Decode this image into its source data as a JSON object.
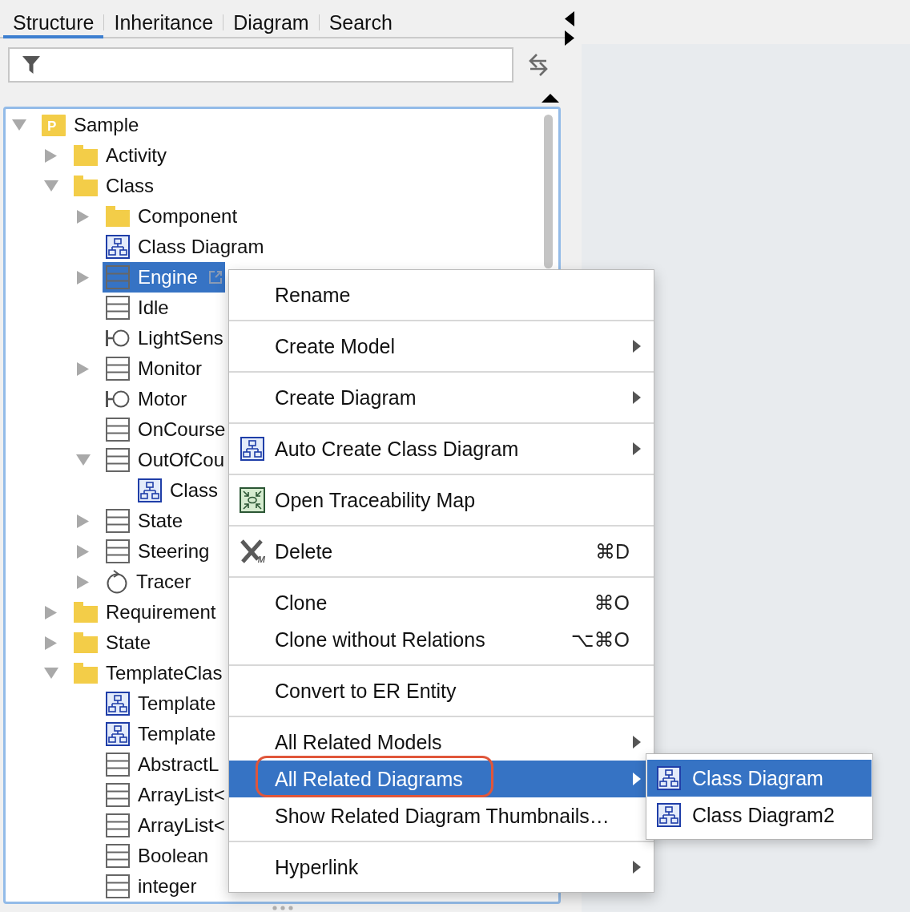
{
  "tabs": [
    {
      "label": "Structure",
      "selected": true
    },
    {
      "label": "Inheritance",
      "selected": false
    },
    {
      "label": "Diagram",
      "selected": false
    },
    {
      "label": "Search",
      "selected": false
    }
  ],
  "tree": [
    {
      "label": "Sample",
      "kind": "project",
      "icon_letter": "P",
      "expanded": true,
      "selected": false,
      "children": [
        {
          "label": "Activity",
          "kind": "folder",
          "expanded": false,
          "selected": false
        },
        {
          "label": "Class",
          "kind": "folder",
          "expanded": true,
          "selected": false,
          "children": [
            {
              "label": "Component",
              "kind": "folder",
              "expanded": false,
              "selected": false
            },
            {
              "label": "Class Diagram",
              "kind": "diagram",
              "selected": false
            },
            {
              "label": "Engine",
              "kind": "class",
              "expanded": false,
              "selected": true,
              "link_icon": true
            },
            {
              "label": "Idle",
              "kind": "class",
              "selected": false
            },
            {
              "label": "LightSens",
              "kind": "interface",
              "selected": false
            },
            {
              "label": "Monitor",
              "kind": "class",
              "expanded": false,
              "selected": false
            },
            {
              "label": "Motor",
              "kind": "interface",
              "selected": false
            },
            {
              "label": "OnCourse",
              "kind": "class",
              "selected": false
            },
            {
              "label": "OutOfCou",
              "kind": "class",
              "expanded": true,
              "selected": false,
              "children": [
                {
                  "label": "Class",
                  "kind": "diagram",
                  "selected": false
                }
              ]
            },
            {
              "label": "State",
              "kind": "class",
              "expanded": false,
              "selected": false
            },
            {
              "label": "Steering",
              "kind": "class",
              "expanded": false,
              "selected": false
            },
            {
              "label": "Tracer",
              "kind": "control",
              "expanded": false,
              "selected": false
            }
          ]
        },
        {
          "label": "Requirement",
          "kind": "folder",
          "expanded": false,
          "selected": false
        },
        {
          "label": "State",
          "kind": "folder",
          "expanded": false,
          "selected": false
        },
        {
          "label": "TemplateClas",
          "kind": "folder",
          "expanded": true,
          "selected": false,
          "children": [
            {
              "label": "Template",
              "kind": "diagram",
              "selected": false
            },
            {
              "label": "Template",
              "kind": "diagram",
              "selected": false
            },
            {
              "label": "AbstractL",
              "kind": "class",
              "selected": false
            },
            {
              "label": "ArrayList<",
              "kind": "class",
              "selected": false
            },
            {
              "label": "ArrayList<",
              "kind": "class",
              "selected": false
            },
            {
              "label": "Boolean",
              "kind": "class",
              "selected": false
            },
            {
              "label": "integer",
              "kind": "class",
              "selected": false
            }
          ]
        }
      ]
    }
  ],
  "context_menu": {
    "groups": [
      {
        "items": [
          {
            "label": "Rename",
            "kind": "plain",
            "submenu": false,
            "highlighted": false
          }
        ]
      },
      {
        "items": [
          {
            "label": "Create Model",
            "kind": "plain",
            "submenu": true,
            "highlighted": false
          }
        ]
      },
      {
        "items": [
          {
            "label": "Create Diagram",
            "kind": "plain",
            "submenu": true,
            "highlighted": false
          }
        ]
      },
      {
        "items": [
          {
            "label": "Auto Create Class Diagram",
            "kind": "diagram",
            "submenu": true,
            "highlighted": false
          }
        ]
      },
      {
        "items": [
          {
            "label": "Open Traceability Map",
            "kind": "traceability",
            "submenu": false,
            "highlighted": false
          }
        ]
      },
      {
        "items": [
          {
            "label": "Delete",
            "kind": "delete",
            "icon_letter": "M",
            "shortcut": "⌘D",
            "submenu": false,
            "highlighted": false
          }
        ]
      },
      {
        "items": [
          {
            "label": "Clone",
            "kind": "plain",
            "shortcut": "⌘O",
            "submenu": false,
            "highlighted": false
          },
          {
            "label": "Clone without Relations",
            "kind": "plain",
            "shortcut": "⌥⌘O",
            "submenu": false,
            "highlighted": false
          }
        ]
      },
      {
        "items": [
          {
            "label": "Convert to ER Entity",
            "kind": "plain",
            "submenu": false,
            "highlighted": false
          }
        ]
      },
      {
        "items": [
          {
            "label": "All Related Models",
            "kind": "plain",
            "submenu": true,
            "highlighted": false
          },
          {
            "label": "All Related Diagrams",
            "kind": "plain",
            "submenu": true,
            "highlighted": true,
            "circled": true
          },
          {
            "label": "Show Related Diagram Thumbnails…",
            "kind": "plain",
            "submenu": false,
            "highlighted": false
          }
        ]
      },
      {
        "items": [
          {
            "label": "Hyperlink",
            "kind": "plain",
            "submenu": true,
            "highlighted": false
          }
        ]
      }
    ]
  },
  "submenu": {
    "items": [
      {
        "label": "Class Diagram",
        "highlighted": true
      },
      {
        "label": "Class Diagram2",
        "highlighted": false
      }
    ]
  }
}
